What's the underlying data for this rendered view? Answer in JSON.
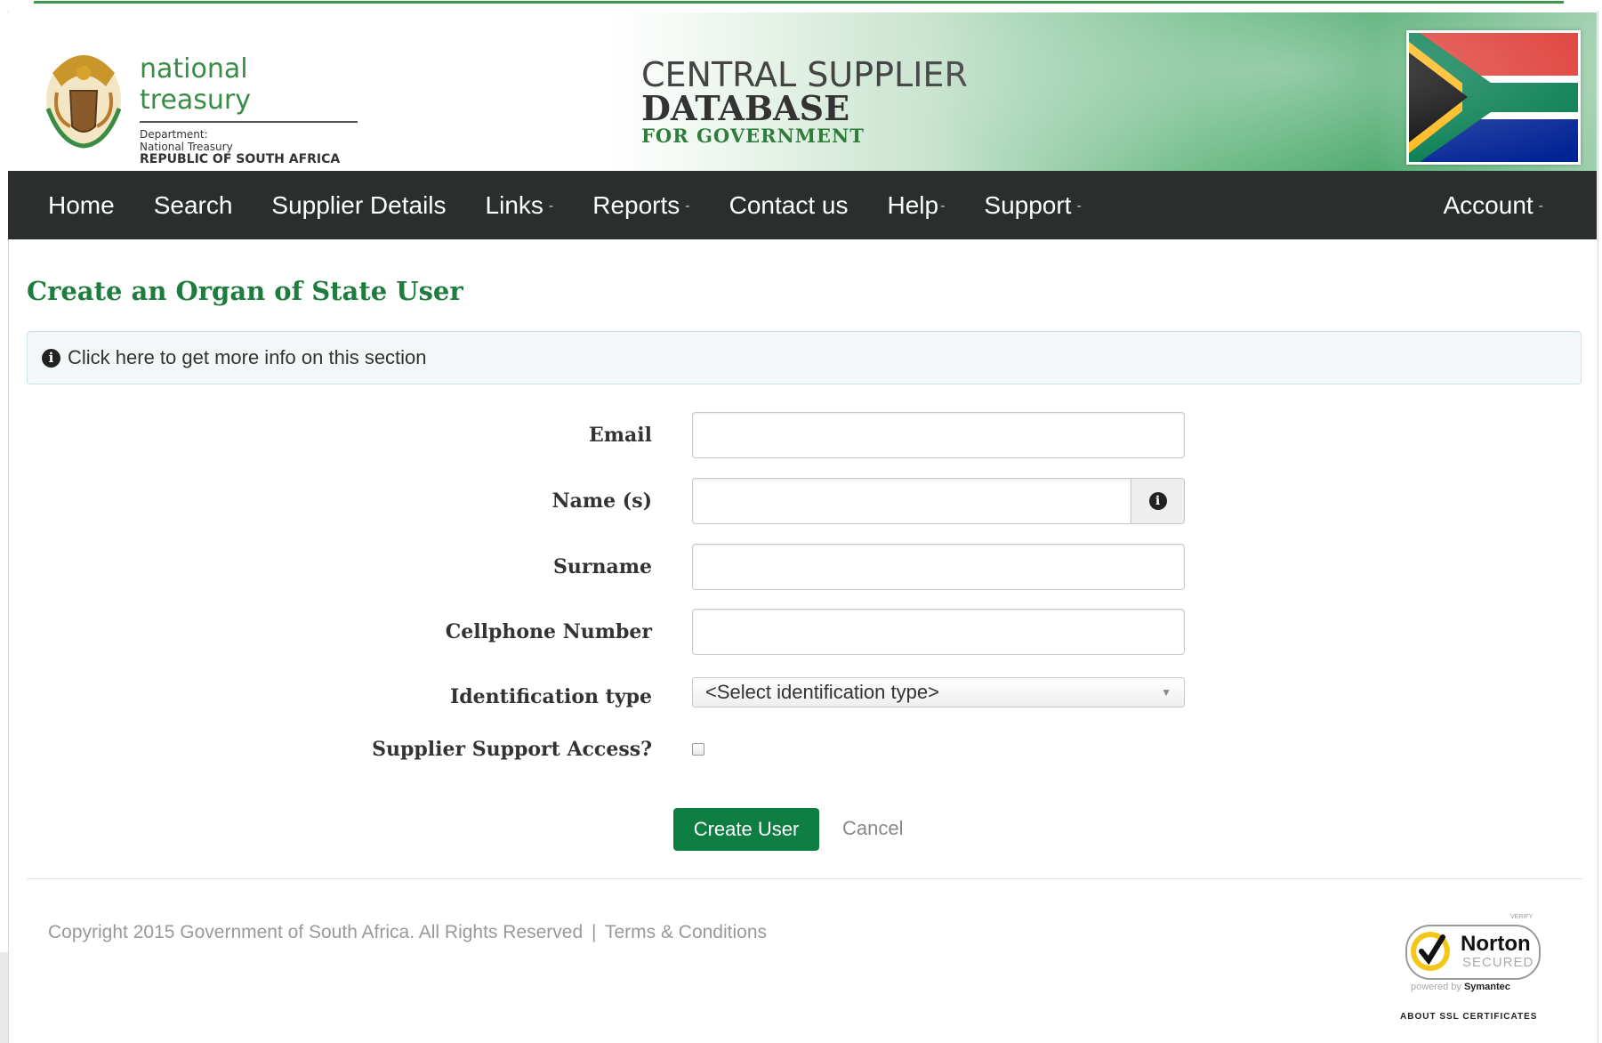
{
  "header": {
    "brand_title": "national treasury",
    "brand_line1": "Department:",
    "brand_line2": "National Treasury",
    "brand_line3": "REPUBLIC OF SOUTH AFRICA",
    "csd_line1": "CENTRAL SUPPLIER",
    "csd_line2": "DATABASE",
    "csd_line3": "FOR GOVERNMENT"
  },
  "nav": {
    "items": [
      {
        "label": "Home"
      },
      {
        "label": "Search"
      },
      {
        "label": "Supplier Details"
      },
      {
        "label": "Links"
      },
      {
        "label": "Reports"
      },
      {
        "label": "Contact us"
      },
      {
        "label": "Help"
      },
      {
        "label": "Support"
      }
    ],
    "account": "Account",
    "caret": "-"
  },
  "page": {
    "title": "Create an Organ of State User",
    "info_text": "Click here to get more info on this section",
    "info_icon": "i"
  },
  "form": {
    "email_label": "Email",
    "email_value": "",
    "names_label": "Name (s)",
    "names_value": "",
    "surname_label": "Surname",
    "surname_value": "",
    "cell_label": "Cellphone Number",
    "cell_value": "",
    "id_type_label": "Identification type",
    "id_type_selected": "<Select identification type>",
    "support_access_label": "Supplier Support Access?",
    "support_access_checked": false,
    "create_button": "Create User",
    "cancel_button": "Cancel"
  },
  "footer": {
    "copyright": "Copyright 2015 Government of South Africa. All Rights Reserved",
    "separator": "|",
    "terms": "Terms & Conditions",
    "norton_verify": "VERIFY",
    "norton_name": "Norton",
    "norton_secured": "SECURED",
    "norton_powered_prefix": "powered by",
    "norton_powered_brand": "Symantec",
    "norton_about": "ABOUT SSL CERTIFICATES"
  },
  "colors": {
    "brand_green": "#1e7d3e",
    "button_green": "#0e7e43",
    "navbar_bg": "#2a2f2d"
  }
}
